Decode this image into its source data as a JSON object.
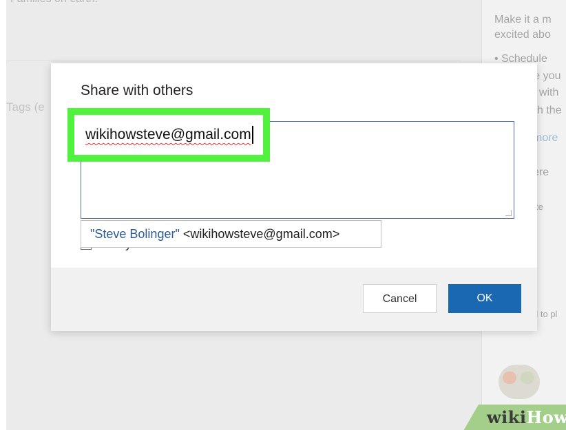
{
  "background": {
    "top_text": "Families on earth.",
    "tags_placeholder": "Tags (e",
    "right_panel": {
      "lines": [
        {
          "text": "Make it a m",
          "link": false,
          "small": false
        },
        {
          "text": "excited abo",
          "link": false,
          "small": false
        },
        {
          "text": "• Schedule",
          "link": false,
          "small": false
        },
        {
          "text": "re you",
          "link": false,
          "small": false
        },
        {
          "text": "t with",
          "link": false,
          "small": false
        },
        {
          "text": "ch the",
          "link": false,
          "small": false
        },
        {
          "text": "more",
          "link": true,
          "small": false
        },
        {
          "text": "ere",
          "link": false,
          "small": false
        },
        {
          "text": "te",
          "link": false,
          "small": true
        },
        {
          "text": "d to pl",
          "link": false,
          "small": true
        }
      ]
    }
  },
  "dialog": {
    "title": "Share with others",
    "share_input_value": "wikihowsteve@gmail.com",
    "notify_label": "Notify via email",
    "cancel_label": "Cancel",
    "ok_label": "OK"
  },
  "suggestion": {
    "name": "\"Steve Bolinger\"",
    "email": " <wikihowsteve@gmail.com>"
  },
  "watermark": {
    "wiki": "wiki",
    "how": "How"
  },
  "colors": {
    "highlight": "#50f23d",
    "ok_button": "#1a68b2",
    "suggestion_name": "#2d5a94"
  }
}
